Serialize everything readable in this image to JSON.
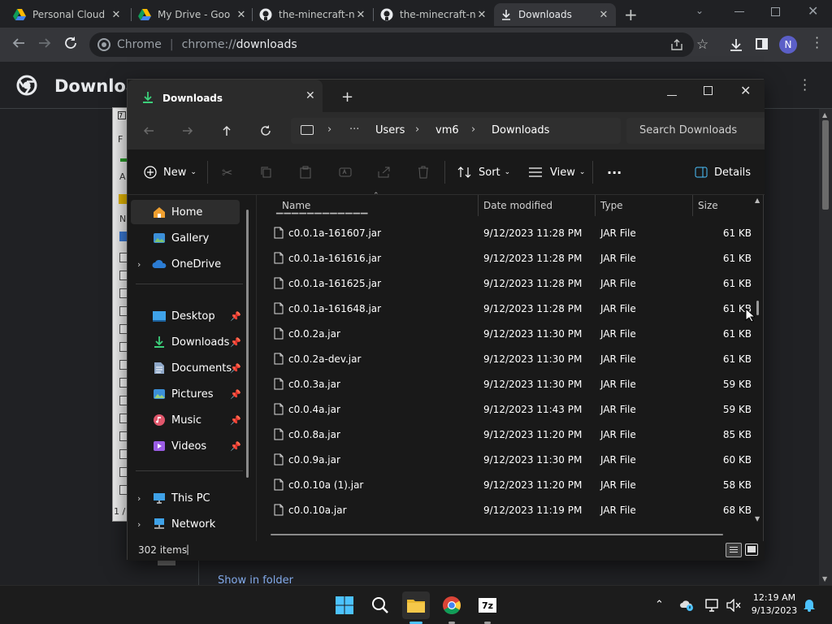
{
  "browser": {
    "tabs": [
      {
        "title": "Personal Cloud",
        "icon": "google-drive-icon"
      },
      {
        "title": "My Drive - Goo",
        "icon": "google-drive-icon"
      },
      {
        "title": "the-minecraft-n",
        "icon": "github-icon"
      },
      {
        "title": "the-minecraft-n",
        "icon": "github-icon"
      },
      {
        "title": "Downloads",
        "icon": "download-icon"
      }
    ],
    "new_tab": "+",
    "omnibox_site": "Chrome",
    "omnibox_scheme": "chrome://",
    "omnibox_path": "downloads",
    "profile_initial": "N",
    "page_title": "Downloa",
    "show_in_folder": "Show in folder",
    "left_window_letters": [
      "F",
      "A",
      "N"
    ],
    "left_window_page": "1 /"
  },
  "explorer": {
    "tab_title": "Downloads",
    "new_tab": "+",
    "breadcrumb": [
      "Users",
      "vm6",
      "Downloads"
    ],
    "breadcrumb_more": "···",
    "search_placeholder": "Search Downloads",
    "cmd": {
      "new": "New",
      "sort": "Sort",
      "view": "View",
      "more": "···",
      "details": "Details"
    },
    "sidebar": {
      "home": "Home",
      "gallery": "Gallery",
      "onedrive": "OneDrive",
      "desktop": "Desktop",
      "downloads": "Downloads",
      "documents": "Documents",
      "pictures": "Pictures",
      "music": "Music",
      "videos": "Videos",
      "thispc": "This PC",
      "network": "Network"
    },
    "columns": {
      "name": "Name",
      "date": "Date modified",
      "type": "Type",
      "size": "Size"
    },
    "files": [
      {
        "name": "c0.0.1a-161607.jar",
        "date": "9/12/2023 11:28 PM",
        "type": "JAR File",
        "size": "61 KB"
      },
      {
        "name": "c0.0.1a-161616.jar",
        "date": "9/12/2023 11:28 PM",
        "type": "JAR File",
        "size": "61 KB"
      },
      {
        "name": "c0.0.1a-161625.jar",
        "date": "9/12/2023 11:28 PM",
        "type": "JAR File",
        "size": "61 KB"
      },
      {
        "name": "c0.0.1a-161648.jar",
        "date": "9/12/2023 11:28 PM",
        "type": "JAR File",
        "size": "61 KB"
      },
      {
        "name": "c0.0.2a.jar",
        "date": "9/12/2023 11:30 PM",
        "type": "JAR File",
        "size": "61 KB"
      },
      {
        "name": "c0.0.2a-dev.jar",
        "date": "9/12/2023 11:30 PM",
        "type": "JAR File",
        "size": "61 KB"
      },
      {
        "name": "c0.0.3a.jar",
        "date": "9/12/2023 11:30 PM",
        "type": "JAR File",
        "size": "59 KB"
      },
      {
        "name": "c0.0.4a.jar",
        "date": "9/12/2023 11:43 PM",
        "type": "JAR File",
        "size": "59 KB"
      },
      {
        "name": "c0.0.8a.jar",
        "date": "9/12/2023 11:20 PM",
        "type": "JAR File",
        "size": "85 KB"
      },
      {
        "name": "c0.0.9a.jar",
        "date": "9/12/2023 11:30 PM",
        "type": "JAR File",
        "size": "60 KB"
      },
      {
        "name": "c0.0.10a (1).jar",
        "date": "9/12/2023 11:20 PM",
        "type": "JAR File",
        "size": "58 KB"
      },
      {
        "name": "c0.0.10a.jar",
        "date": "9/12/2023 11:19 PM",
        "type": "JAR File",
        "size": "68 KB"
      }
    ],
    "status_items": "302 items",
    "status_cursor": "|"
  },
  "taskbar": {
    "time": "12:19 AM",
    "date": "9/13/2023",
    "app_7z": "7z"
  },
  "colors": {
    "chrome_bg": "#202124",
    "chrome_toolbar": "#35363a",
    "explorer_bg": "#191919",
    "explorer_nav": "#2b2b2b",
    "accent_blue": "#4cc2ff",
    "taskbar_bg": "#1c1c1c"
  }
}
